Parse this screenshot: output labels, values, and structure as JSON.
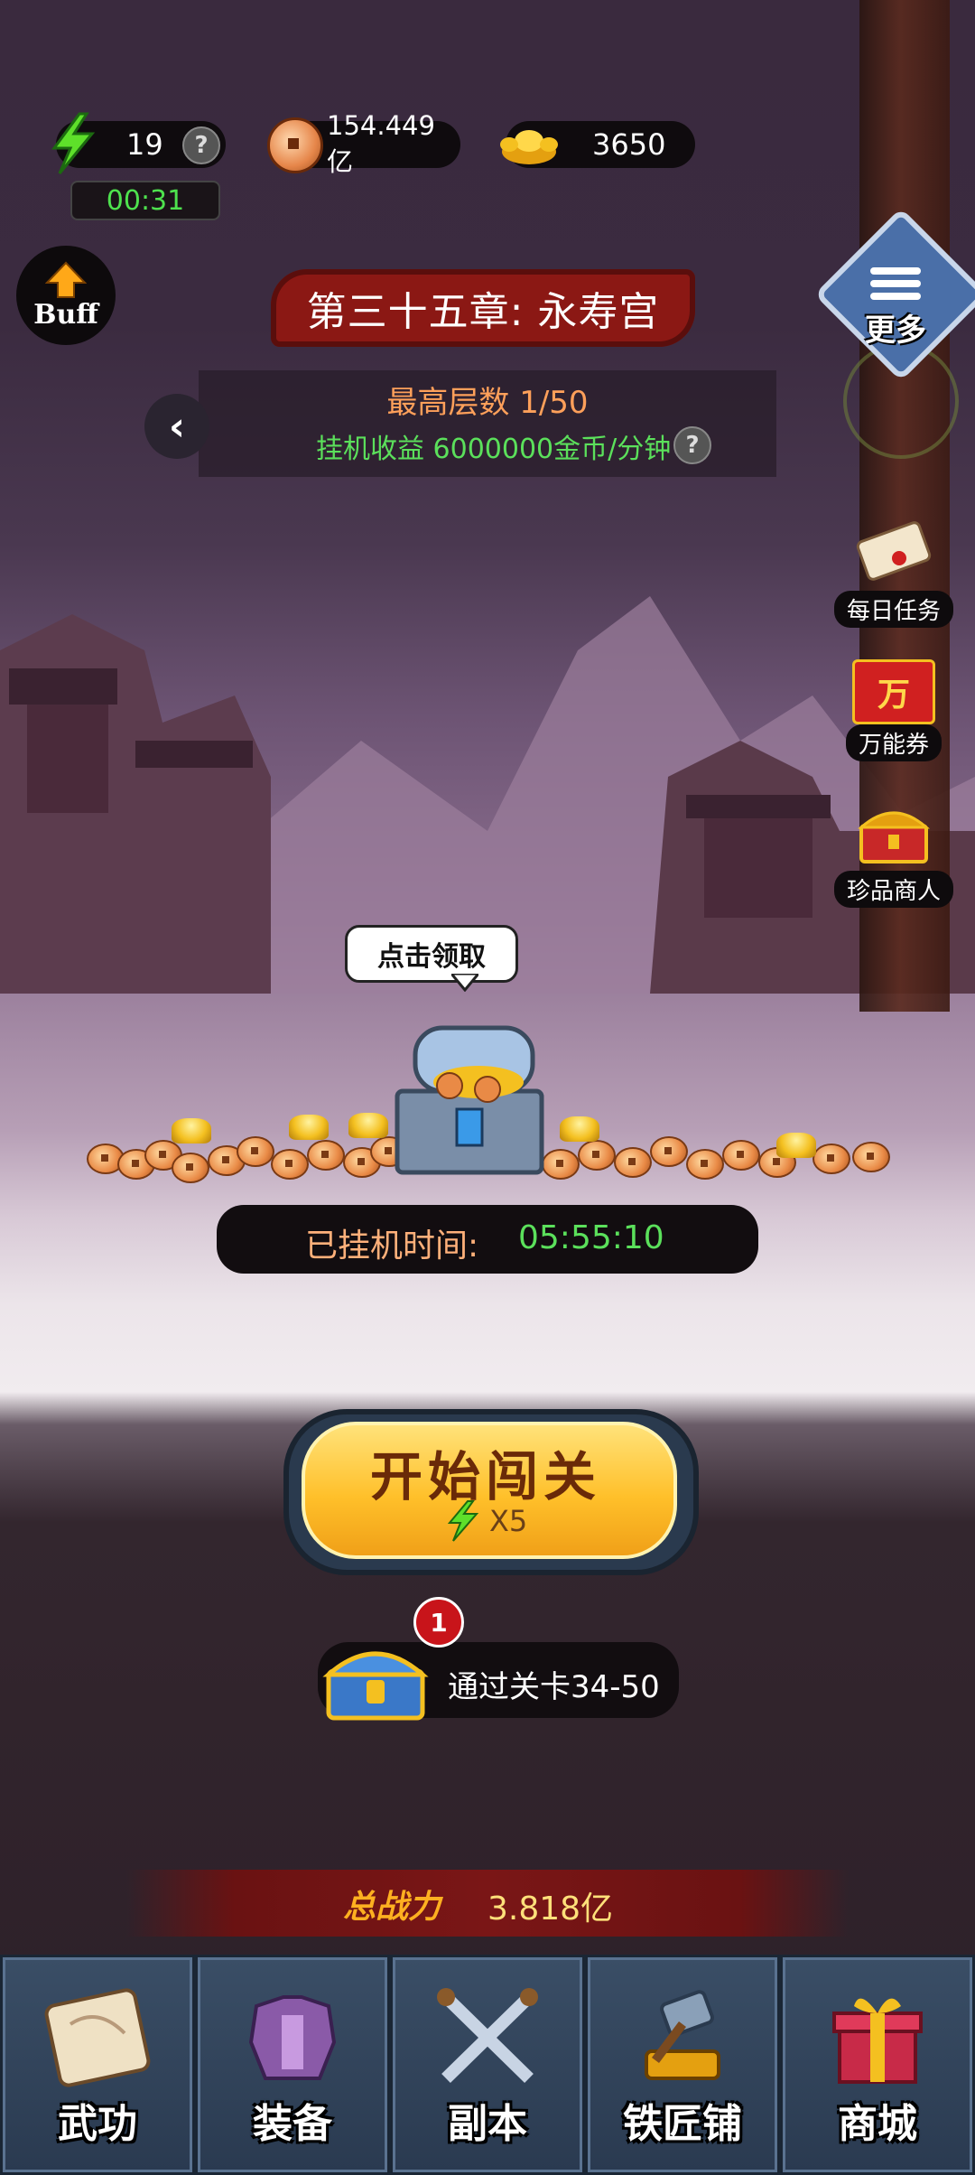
{
  "resources": {
    "energy": "19",
    "energy_timer": "00:31",
    "coins": "154.449亿",
    "gold": "3650"
  },
  "buff": {
    "label": "Buff"
  },
  "chapter": {
    "title": "第三十五章: 永寿宫",
    "max_floor": "最高层数 1/50",
    "idle_income": "挂机收益 6000000金币/分钟"
  },
  "side_menu": {
    "more": "更多",
    "daily_tasks": "每日任务",
    "universal_voucher": "万能券",
    "voucher_icon_char": "万",
    "treasure_merchant": "珍品商人"
  },
  "chest": {
    "bubble": "点击领取"
  },
  "idle_time": {
    "label": "已挂机时间:",
    "value": "05:55:10"
  },
  "start": {
    "label": "开始闯关",
    "cost": "X5"
  },
  "reward": {
    "badge": "1",
    "text": "通过关卡34-50"
  },
  "power": {
    "label": "总战力",
    "value": "3.818亿"
  },
  "nav": [
    {
      "label": "武功",
      "icon": "scroll-icon"
    },
    {
      "label": "装备",
      "icon": "armor-icon"
    },
    {
      "label": "副本",
      "icon": "crossed-swords-icon"
    },
    {
      "label": "铁匠铺",
      "icon": "hammer-anvil-icon"
    },
    {
      "label": "商城",
      "icon": "gift-box-icon"
    }
  ],
  "colors": {
    "green": "#5be05b",
    "orange": "#ffa05a",
    "banner_red": "#8b1814",
    "button_gold": "#ffc02a",
    "nav_blue": "#2a3a50"
  }
}
